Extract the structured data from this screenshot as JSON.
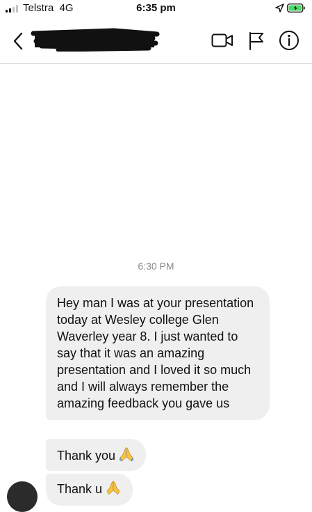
{
  "status_bar": {
    "carrier": "Telstra",
    "network": "4G",
    "time": "6:35 pm"
  },
  "header": {
    "contact_name": "",
    "back_icon": "chevron-left-icon",
    "video_icon": "video-camera-icon",
    "flag_icon": "flag-icon",
    "info_icon": "info-icon"
  },
  "conversation": {
    "timestamp": "6:30 PM",
    "messages": [
      {
        "text": "Hey man I was at your presentation today at Wesley college Glen Waverley year 8. I just wanted to say that it was an amazing presentation and I loved it so much and I will always remember the amazing feedback you gave us"
      },
      {
        "text": "Thank you",
        "emoji": "folded-hands"
      },
      {
        "text": "Thank u",
        "emoji": "folded-hands"
      }
    ]
  },
  "colors": {
    "bubble": "#efefef",
    "timestamp": "#8a8a8e",
    "divider": "#d6d6d6",
    "battery_fill": "#4cd964"
  }
}
